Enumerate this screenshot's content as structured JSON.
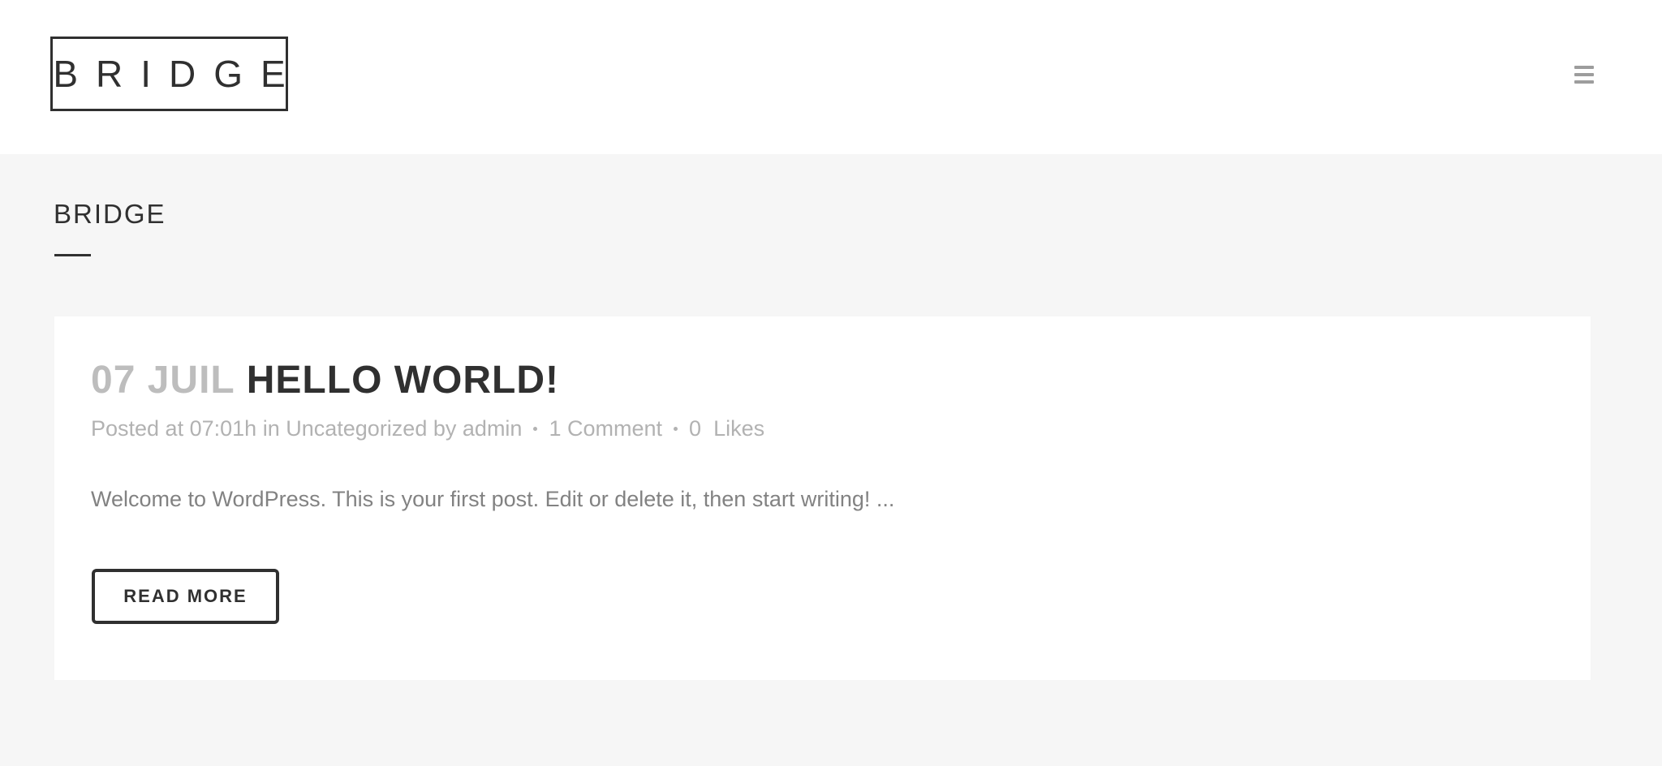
{
  "header": {
    "logo_text": "BRIDGE",
    "menu_icon": "hamburger-icon"
  },
  "page": {
    "title": "BRIDGE"
  },
  "post": {
    "date": "07 JUIL",
    "title": "HELLO WORLD!",
    "meta": {
      "posted_prefix": "Posted at",
      "time": "07:01h",
      "in_label": "in",
      "category": "Uncategorized",
      "by_label": "by",
      "author": "admin",
      "comments": "1 Comment",
      "likes_count": "0",
      "likes_label": "Likes"
    },
    "excerpt": "Welcome to WordPress. This is your first post. Edit or delete it, then start writing! ...",
    "read_more_label": "READ MORE"
  },
  "colors": {
    "background": "#f6f6f6",
    "text_dark": "#303030",
    "text_muted": "#b2b2b2",
    "date_color": "#bdbdbd"
  }
}
